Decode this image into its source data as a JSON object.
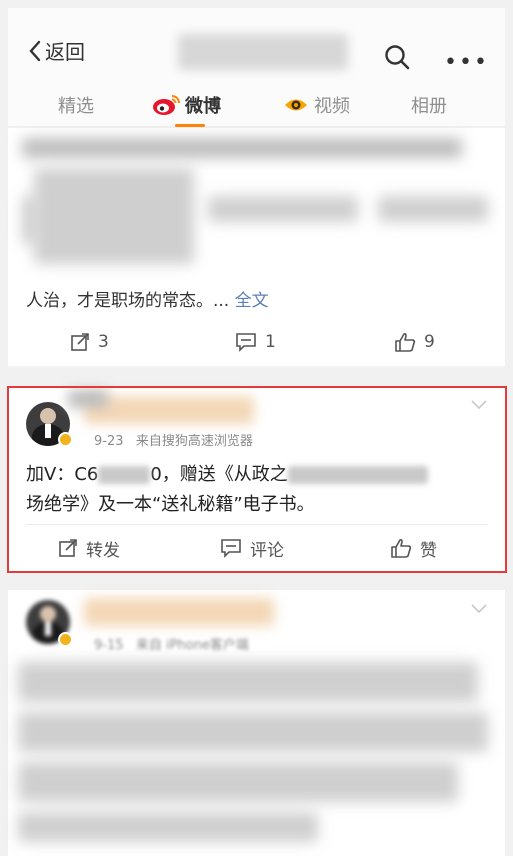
{
  "header": {
    "back_label": "返回",
    "title": "",
    "icons": {
      "back": "chevron-left-icon",
      "search": "search-icon",
      "more": "more-dots-icon"
    }
  },
  "tabs": [
    {
      "label": "精选",
      "active": false
    },
    {
      "label": "微博",
      "active": true,
      "icon": "weibo-logo-icon"
    },
    {
      "label": "视频",
      "active": false,
      "icon": "video-eye-icon"
    },
    {
      "label": "相册",
      "active": false
    }
  ],
  "post1": {
    "partial_text": "人治，才是职场的常态。...",
    "full_link": "全文",
    "actions": {
      "repost": "3",
      "comment": "1",
      "like": "9"
    }
  },
  "post2": {
    "time": "9-23",
    "source": "来自搜狗高速浏览器",
    "text_part1": "加V：C6",
    "text_part2": "0，赠送《从政之",
    "text_part3": "场绝学》及一本“送礼秘籍”电子书。",
    "actions": {
      "repost": "转发",
      "comment": "评论",
      "like": "赞"
    }
  },
  "post3": {
    "time": "9-15",
    "source": "来自 iPhone客户端"
  },
  "colors": {
    "accent": "#ff8200",
    "highlight_border": "#e23b3b",
    "link": "#5b7fb6",
    "verified_badge": "#f2b21d"
  }
}
